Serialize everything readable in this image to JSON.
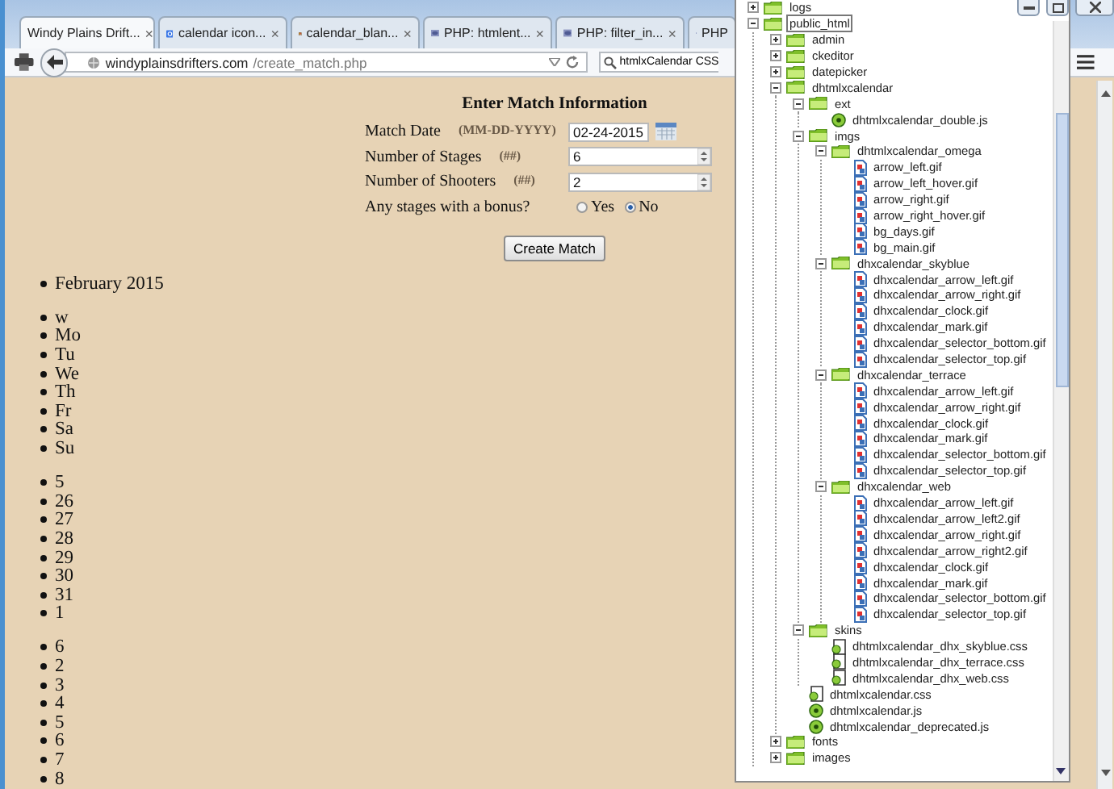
{
  "browser": {
    "tabs": [
      {
        "title": "Windy Plains Drift...",
        "kind": "site",
        "selected": true,
        "close": "×"
      },
      {
        "title": "calendar icon...",
        "kind": "google",
        "selected": false,
        "close": "×"
      },
      {
        "title": "calendar_blan...",
        "kind": "image",
        "selected": false,
        "close": "×"
      },
      {
        "title": "PHP: htmlent...",
        "kind": "php",
        "selected": false,
        "close": "×"
      },
      {
        "title": "PHP: filter_in...",
        "kind": "php",
        "selected": false,
        "close": "×"
      },
      {
        "title": "PHP",
        "kind": "php",
        "selected": false
      }
    ],
    "address": {
      "domain": "windyplainsdrifters.com",
      "path": "/create_match.php"
    },
    "search": {
      "value": "htmlxCalendar CSS"
    }
  },
  "form": {
    "title": "Enter Match Information",
    "fields": [
      {
        "label": "Match Date",
        "hint": "(MM-DD-YYYY)",
        "value": "02-24-2015",
        "kind": "date"
      },
      {
        "label": "Number of Stages",
        "hint": "(##)",
        "value": "6",
        "kind": "number"
      },
      {
        "label": "Number of Shooters",
        "hint": "(##)",
        "value": "2",
        "kind": "number"
      }
    ],
    "bonus": {
      "question": "Any stages with a bonus?",
      "options": [
        {
          "label": "Yes",
          "selected": false
        },
        {
          "label": "No",
          "selected": true
        }
      ]
    },
    "button": "Create Match"
  },
  "calendar_list": {
    "month": "February 2015",
    "groups": [
      [
        "w",
        "Mo",
        "Tu",
        "We",
        "Th",
        "Fr",
        "Sa",
        "Su"
      ],
      [
        "5",
        "26",
        "27",
        "28",
        "29",
        "30",
        "31",
        "1"
      ],
      [
        "6",
        "2",
        "3",
        "4",
        "5",
        "6",
        "7",
        "8"
      ]
    ]
  },
  "tree": {
    "items": [
      {
        "label": "logs",
        "kind": "folder",
        "expanded": false,
        "selected": false
      },
      {
        "label": "public_html",
        "kind": "folder",
        "expanded": true,
        "selected": true,
        "children": [
          {
            "label": "admin",
            "kind": "folder",
            "expanded": false,
            "selected": false
          },
          {
            "label": "ckeditor",
            "kind": "folder",
            "expanded": false,
            "selected": false
          },
          {
            "label": "datepicker",
            "kind": "folder",
            "expanded": false,
            "selected": false
          },
          {
            "label": "dhtmlxcalendar",
            "kind": "folder",
            "expanded": true,
            "selected": false,
            "children": [
              {
                "label": "ext",
                "kind": "folder",
                "expanded": true,
                "selected": false,
                "children": [
                  {
                    "label": "dhtmlxcalendar_double.js",
                    "kind": "js",
                    "selected": false
                  }
                ]
              },
              {
                "label": "imgs",
                "kind": "folder",
                "expanded": true,
                "selected": false,
                "children": [
                  {
                    "label": "dhtmlxcalendar_omega",
                    "kind": "folder",
                    "expanded": true,
                    "selected": false,
                    "children": [
                      {
                        "label": "arrow_left.gif",
                        "kind": "gif",
                        "selected": false
                      },
                      {
                        "label": "arrow_left_hover.gif",
                        "kind": "gif",
                        "selected": false
                      },
                      {
                        "label": "arrow_right.gif",
                        "kind": "gif",
                        "selected": false
                      },
                      {
                        "label": "arrow_right_hover.gif",
                        "kind": "gif",
                        "selected": false
                      },
                      {
                        "label": "bg_days.gif",
                        "kind": "gif",
                        "selected": false
                      },
                      {
                        "label": "bg_main.gif",
                        "kind": "gif",
                        "selected": false
                      }
                    ]
                  },
                  {
                    "label": "dhxcalendar_skyblue",
                    "kind": "folder",
                    "expanded": true,
                    "selected": false,
                    "children": [
                      {
                        "label": "dhxcalendar_arrow_left.gif",
                        "kind": "gif",
                        "selected": false
                      },
                      {
                        "label": "dhxcalendar_arrow_right.gif",
                        "kind": "gif",
                        "selected": false
                      },
                      {
                        "label": "dhxcalendar_clock.gif",
                        "kind": "gif",
                        "selected": false
                      },
                      {
                        "label": "dhxcalendar_mark.gif",
                        "kind": "gif",
                        "selected": false
                      },
                      {
                        "label": "dhxcalendar_selector_bottom.gif",
                        "kind": "gif",
                        "selected": false
                      },
                      {
                        "label": "dhxcalendar_selector_top.gif",
                        "kind": "gif",
                        "selected": false
                      }
                    ]
                  },
                  {
                    "label": "dhxcalendar_terrace",
                    "kind": "folder",
                    "expanded": true,
                    "selected": false,
                    "children": [
                      {
                        "label": "dhxcalendar_arrow_left.gif",
                        "kind": "gif",
                        "selected": false
                      },
                      {
                        "label": "dhxcalendar_arrow_right.gif",
                        "kind": "gif",
                        "selected": false
                      },
                      {
                        "label": "dhxcalendar_clock.gif",
                        "kind": "gif",
                        "selected": false
                      },
                      {
                        "label": "dhxcalendar_mark.gif",
                        "kind": "gif",
                        "selected": false
                      },
                      {
                        "label": "dhxcalendar_selector_bottom.gif",
                        "kind": "gif",
                        "selected": false
                      },
                      {
                        "label": "dhxcalendar_selector_top.gif",
                        "kind": "gif",
                        "selected": false
                      }
                    ]
                  },
                  {
                    "label": "dhxcalendar_web",
                    "kind": "folder",
                    "expanded": true,
                    "selected": false,
                    "children": [
                      {
                        "label": "dhxcalendar_arrow_left.gif",
                        "kind": "gif",
                        "selected": false
                      },
                      {
                        "label": "dhxcalendar_arrow_left2.gif",
                        "kind": "gif",
                        "selected": false
                      },
                      {
                        "label": "dhxcalendar_arrow_right.gif",
                        "kind": "gif",
                        "selected": false
                      },
                      {
                        "label": "dhxcalendar_arrow_right2.gif",
                        "kind": "gif",
                        "selected": false
                      },
                      {
                        "label": "dhxcalendar_clock.gif",
                        "kind": "gif",
                        "selected": false
                      },
                      {
                        "label": "dhxcalendar_mark.gif",
                        "kind": "gif",
                        "selected": false
                      },
                      {
                        "label": "dhxcalendar_selector_bottom.gif",
                        "kind": "gif",
                        "selected": false
                      },
                      {
                        "label": "dhxcalendar_selector_top.gif",
                        "kind": "gif",
                        "selected": false
                      }
                    ]
                  }
                ]
              },
              {
                "label": "skins",
                "kind": "folder",
                "expanded": true,
                "selected": false,
                "children": [
                  {
                    "label": "dhtmlxcalendar_dhx_skyblue.css",
                    "kind": "css",
                    "selected": false
                  },
                  {
                    "label": "dhtmlxcalendar_dhx_terrace.css",
                    "kind": "css",
                    "selected": false
                  },
                  {
                    "label": "dhtmlxcalendar_dhx_web.css",
                    "kind": "css",
                    "selected": false
                  }
                ]
              },
              {
                "label": "dhtmlxcalendar.css",
                "kind": "css",
                "selected": false
              },
              {
                "label": "dhtmlxcalendar.js",
                "kind": "js",
                "selected": false
              },
              {
                "label": "dhtmlxcalendar_deprecated.js",
                "kind": "js",
                "selected": false
              }
            ]
          },
          {
            "label": "fonts",
            "kind": "folder",
            "expanded": false,
            "selected": false
          },
          {
            "label": "images",
            "kind": "folder",
            "expanded": false,
            "selected": false
          }
        ]
      }
    ]
  }
}
